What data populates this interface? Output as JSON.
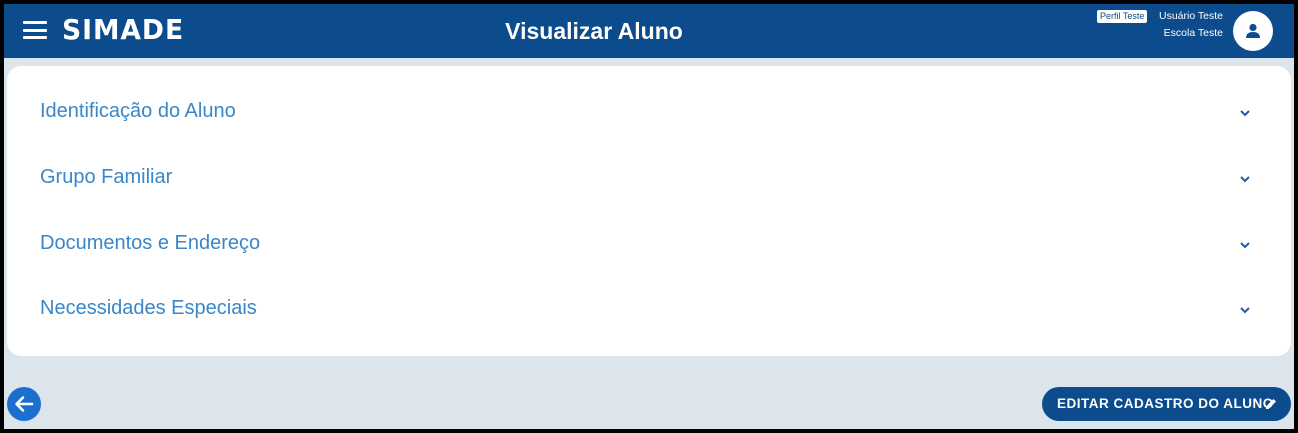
{
  "header": {
    "brand": "SIMADE",
    "title": "Visualizar Aluno",
    "profile_badge": "Perfil Teste",
    "user_name": "Usuário Teste",
    "school_name": "Escola Teste",
    "menu_icon": "hamburger-menu-icon",
    "avatar_icon": "person-icon"
  },
  "sections": [
    {
      "label": "Identificação do Aluno",
      "icon": "chevron-down-icon"
    },
    {
      "label": "Grupo Familiar",
      "icon": "chevron-down-icon"
    },
    {
      "label": "Documentos e Endereço",
      "icon": "chevron-down-icon"
    },
    {
      "label": "Necessidades Especiais",
      "icon": "chevron-down-icon"
    }
  ],
  "footer": {
    "back_icon": "arrow-left-icon",
    "edit_label": "EDITAR CADASTRO DO ALUNO",
    "edit_icon": "pencil-icon"
  },
  "colors": {
    "header_bg": "#0d4c8c",
    "page_bg": "#dce4ec",
    "section_text": "#3a86c8",
    "back_button": "#1b6fd0"
  }
}
